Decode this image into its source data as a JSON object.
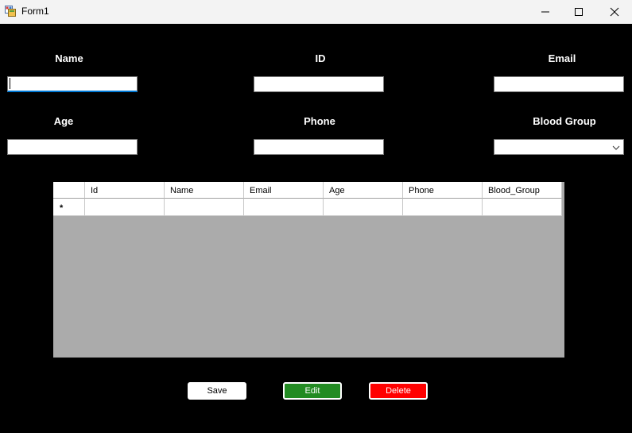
{
  "window": {
    "title": "Form1"
  },
  "colors": {
    "form_bg": "#000000",
    "grid_bg": "#ababab",
    "edit_btn": "#228b22",
    "delete_btn": "#ff0000"
  },
  "form": {
    "labels": {
      "name": "Name",
      "id": "ID",
      "email": "Email",
      "age": "Age",
      "phone": "Phone",
      "blood_group": "Blood Group"
    },
    "fields": {
      "name": "",
      "id": "",
      "email": "",
      "age": "",
      "phone": "",
      "blood_group": ""
    }
  },
  "grid": {
    "columns": [
      "Id",
      "Name",
      "Email",
      "Age",
      "Phone",
      "Blood_Group"
    ],
    "new_row_marker": "*",
    "rows": []
  },
  "buttons": {
    "save": "Save",
    "edit": "Edit",
    "delete": "Delete"
  },
  "icons": {
    "app": "app-icon",
    "minimize": "minimize-icon",
    "maximize": "maximize-icon",
    "close": "close-icon",
    "dropdown": "chevron-down-icon"
  }
}
